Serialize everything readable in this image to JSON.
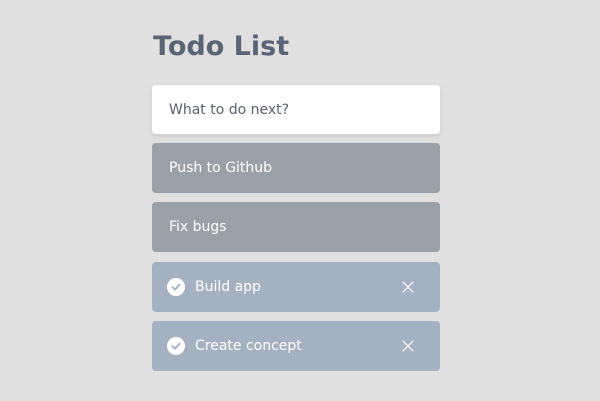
{
  "app": {
    "title": "Todo List"
  },
  "input": {
    "placeholder": "What to do next?",
    "value": ""
  },
  "todos": [
    {
      "label": "Push to Github",
      "completed": false
    },
    {
      "label": "Fix bugs",
      "completed": false
    },
    {
      "label": "Build app",
      "completed": true
    },
    {
      "label": "Create concept",
      "completed": true
    }
  ],
  "icons": {
    "check": "check-circle-icon",
    "delete": "close-icon"
  },
  "colors": {
    "background": "#e0e0e0",
    "title": "#5a6478",
    "active_item": "#9aa0a8",
    "completed_item": "#a4b1c1",
    "input_background": "#ffffff"
  }
}
